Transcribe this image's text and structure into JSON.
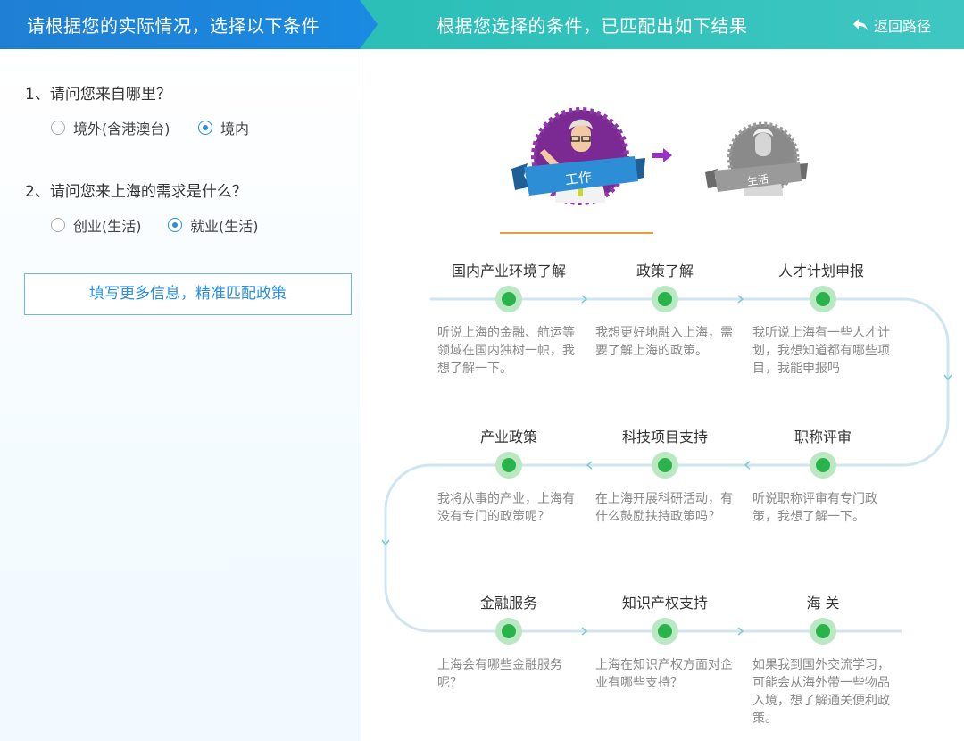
{
  "header": {
    "left_title": "请根据您的实际情况，选择以下条件",
    "right_title": "根据您选择的条件，已匹配出如下结果",
    "back_label": "返回路径"
  },
  "questions": [
    {
      "label": "1、请问您来自哪里？",
      "options": [
        "境外(含港澳台)",
        "境内"
      ],
      "selected": 1
    },
    {
      "label": "2、请问您来上海的需求是什么？",
      "options": [
        "创业(生活)",
        "就业(生活)"
      ],
      "selected": 1
    }
  ],
  "match_button": "填写更多信息，精准匹配政策",
  "characters": {
    "work_label": "工作",
    "life_label": "生活"
  },
  "steps": [
    {
      "title": "国内产业环境了解",
      "desc": "听说上海的金融、航运等领域在国内独树一帜，我想了解一下。"
    },
    {
      "title": "政策了解",
      "desc": "我想更好地融入上海，需要了解上海的政策。"
    },
    {
      "title": "人才计划申报",
      "desc": "我听说上海有一些人才计划，我想知道都有哪些项目，我能申报吗"
    },
    {
      "title": "产业政策",
      "desc": "我将从事的产业，上海有没有专门的政策呢？"
    },
    {
      "title": "科技项目支持",
      "desc": "在上海开展科研活动，有什么鼓励扶持政策吗？"
    },
    {
      "title": "职称评审",
      "desc": "听说职称评审有专门政策，我想了解一下。"
    },
    {
      "title": "金融服务",
      "desc": "上海会有哪些金融服务呢？"
    },
    {
      "title": "知识产权支持",
      "desc": "上海在知识产权方面对企业有哪些支持？"
    },
    {
      "title": "海 关",
      "desc": "如果我到国外交流学习，可能会从海外带一些物品入境，想了解通关便利政策。"
    }
  ],
  "colors": {
    "left_header": "#1a8ae2",
    "right_header": "#2bbfb8",
    "accent_blue": "#2a8de0",
    "node_green": "#29b34a",
    "track": "#cfe6f2",
    "underline": "#f09a3e"
  }
}
